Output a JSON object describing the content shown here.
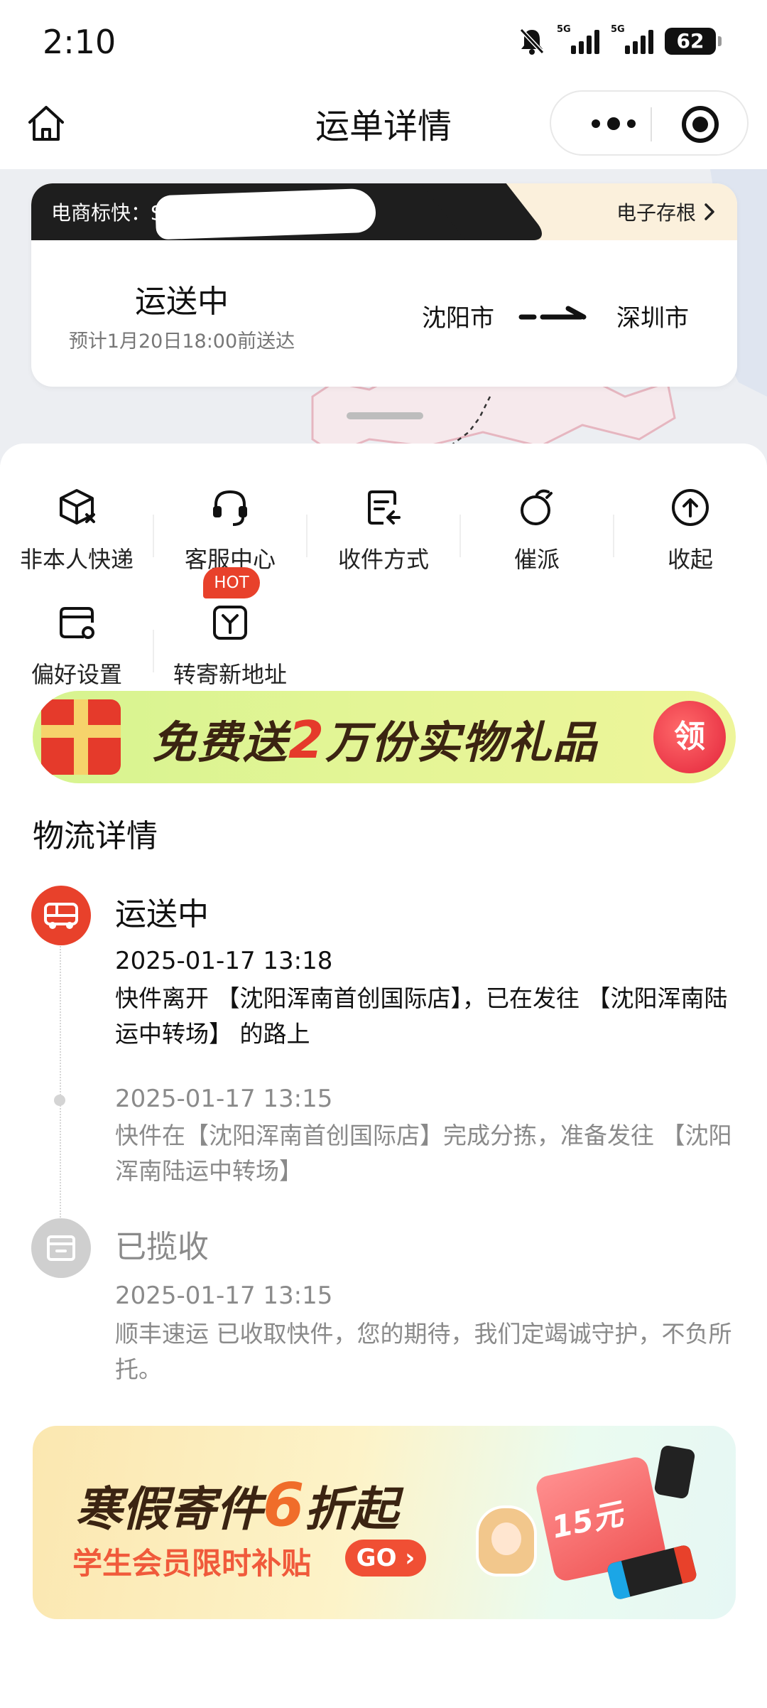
{
  "status_bar": {
    "time": "2:10",
    "signal1_tag": "5G",
    "signal2_tag": "5G",
    "battery": "62"
  },
  "nav": {
    "title": "运单详情"
  },
  "waybill": {
    "label": "电商标快：S",
    "ereceipt_label": "电子存根",
    "status": "运送中",
    "eta": "预计1月20日18:00前送达",
    "from_city": "沈阳市",
    "to_city": "深圳市"
  },
  "actions": [
    {
      "label": "非本人快递",
      "icon": "package-x-icon"
    },
    {
      "label": "客服中心",
      "icon": "headset-icon"
    },
    {
      "label": "收件方式",
      "icon": "edit-doc-icon"
    },
    {
      "label": "催派",
      "icon": "stopwatch-icon"
    },
    {
      "label": "收起",
      "icon": "arrow-up-circle-icon"
    },
    {
      "label": "偏好设置",
      "icon": "preference-icon"
    },
    {
      "label": "转寄新地址",
      "icon": "fork-icon"
    }
  ],
  "hot_badge": "HOT",
  "gift_banner": {
    "text_before": "免费送",
    "number": "2",
    "text_after": "万份实物礼品",
    "claim": "领"
  },
  "logistics": {
    "section_title": "物流详情",
    "events": [
      {
        "title": "运送中",
        "time": "2025-01-17 13:18",
        "desc": "快件离开 【沈阳浑南首创国际店】，已在发往 【沈阳浑南陆运中转场】 的路上"
      },
      {
        "title": "",
        "time": "2025-01-17 13:15",
        "desc": "快件在【沈阳浑南首创国际店】完成分拣，准备发往 【沈阳浑南陆运中转场】"
      },
      {
        "title": "已揽收",
        "time": "2025-01-17 13:15",
        "desc": "顺丰速运 已收取快件，您的期待，我们定竭诚守护，不负所托。"
      }
    ]
  },
  "winter_banner": {
    "title_before": "寒假寄件",
    "number": "6",
    "title_after": "折起",
    "subtitle": "学生会员限时补贴",
    "go": "GO",
    "ticket": "15元"
  },
  "colors": {
    "accent_red": "#e8412b",
    "card_header_dark": "#1e1e1e",
    "card_header_light": "#fbf0dc"
  }
}
